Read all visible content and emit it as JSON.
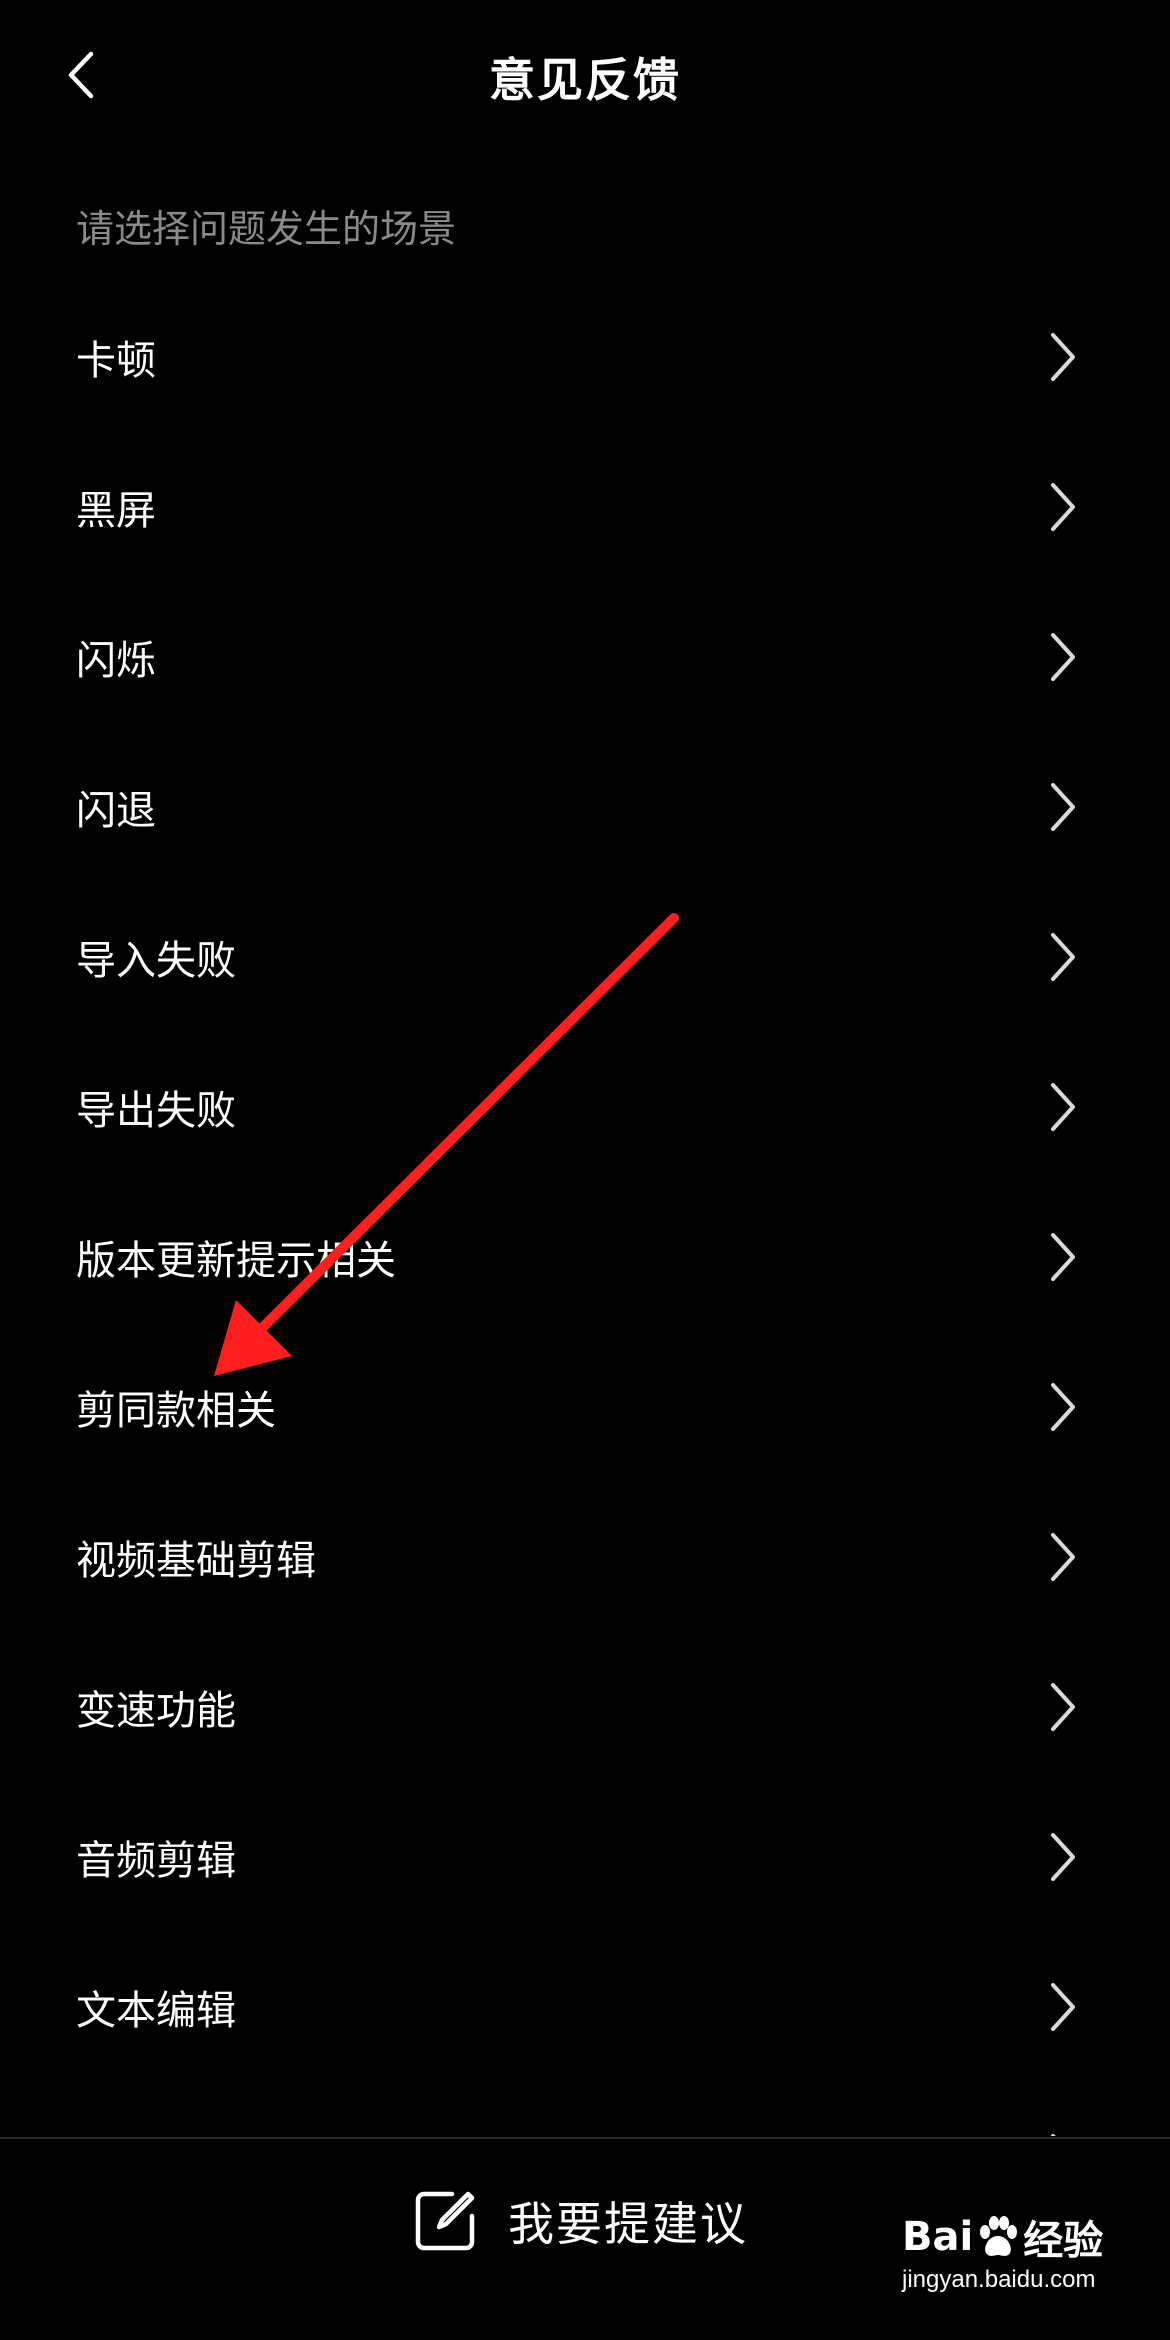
{
  "header": {
    "title": "意见反馈",
    "back_icon": "chevron-left-icon"
  },
  "section_hint": "请选择问题发生的场景",
  "items": [
    {
      "label": "卡顿"
    },
    {
      "label": "黑屏"
    },
    {
      "label": "闪烁"
    },
    {
      "label": "闪退"
    },
    {
      "label": "导入失败"
    },
    {
      "label": "导出失败"
    },
    {
      "label": "版本更新提示相关"
    },
    {
      "label": "剪同款相关"
    },
    {
      "label": "视频基础剪辑"
    },
    {
      "label": "变速功能"
    },
    {
      "label": "音频剪辑"
    },
    {
      "label": "文本编辑"
    }
  ],
  "bottom": {
    "suggest_label": "我要提建议",
    "icon": "edit-icon"
  },
  "watermark": {
    "logo_left": "Bai",
    "logo_right": "经验",
    "url": "jingyan.baidu.com"
  },
  "colors": {
    "background": "#000000",
    "text": "#ffffff",
    "hint": "#8a8a8a",
    "chevron": "#d9d9d9",
    "annotation": "#ff1f1f"
  }
}
